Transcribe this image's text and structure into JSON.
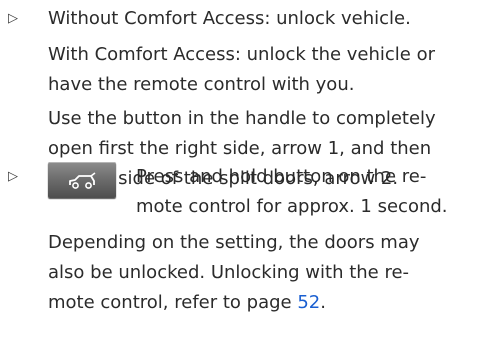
{
  "list": {
    "bullet_symbol": "▷",
    "item1": {
      "line1": "Without Comfort Access: unlock vehicle.",
      "para2_line1": "With Comfort Access: unlock the vehicle or",
      "para2_line2": "have the remote control with you.",
      "para3_line1": "Use the button in the handle to completely",
      "para3_line2": "open first the right side, arrow 1, and then",
      "para3_line3": "the left side of the split doors, arrow 2."
    },
    "item2": {
      "button_icon": "tailgate-icon",
      "line1": "Press and hold button on the re-",
      "line2": "mote control for approx. 1 second.",
      "para2_line1": "Depending on the setting, the doors may",
      "para2_line2": "also be unlocked. Unlocking with the re-",
      "para2_line3_prefix": "mote control, refer to page ",
      "page_ref": "52",
      "para2_line3_suffix": "."
    }
  },
  "colors": {
    "text": "#2b2b2b",
    "link": "#1a5fd1",
    "button_gray": "#6e6e6e"
  }
}
